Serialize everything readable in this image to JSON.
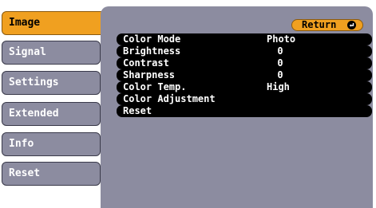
{
  "tabs": [
    {
      "label": "Image",
      "active": true
    },
    {
      "label": "Signal",
      "active": false
    },
    {
      "label": "Settings",
      "active": false
    },
    {
      "label": "Extended",
      "active": false
    },
    {
      "label": "Info",
      "active": false
    },
    {
      "label": "Reset",
      "active": false
    }
  ],
  "return_label": "Return",
  "menu": [
    {
      "label": "Color Mode",
      "value": "Photo"
    },
    {
      "label": "Brightness",
      "value": "0"
    },
    {
      "label": "Contrast",
      "value": "0"
    },
    {
      "label": "Sharpness",
      "value": "0"
    },
    {
      "label": "Color Temp.",
      "value": "High"
    },
    {
      "label": "Color Adjustment",
      "value": ""
    },
    {
      "label": "Reset",
      "value": ""
    }
  ],
  "colors": {
    "accent": "#f0a020",
    "tab_bg": "#8c8ca0",
    "row_bg": "#000000"
  }
}
